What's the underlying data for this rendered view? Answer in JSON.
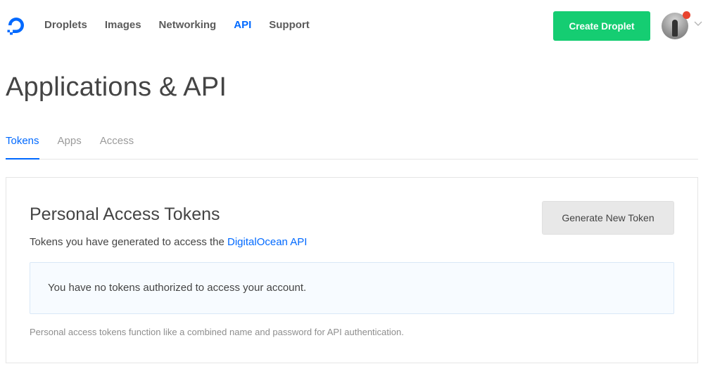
{
  "header": {
    "logo_icon": "digitalocean-logo-icon",
    "nav": [
      {
        "label": "Droplets",
        "active": false
      },
      {
        "label": "Images",
        "active": false
      },
      {
        "label": "Networking",
        "active": false
      },
      {
        "label": "API",
        "active": true
      },
      {
        "label": "Support",
        "active": false
      }
    ],
    "create_button_label": "Create Droplet",
    "avatar_icon": "user-avatar",
    "notification_color": "#e8442f",
    "accent_color": "#0069ff",
    "create_button_color": "#15cd72"
  },
  "page": {
    "title": "Applications & API",
    "tabs": [
      {
        "label": "Tokens",
        "active": true
      },
      {
        "label": "Apps",
        "active": false
      },
      {
        "label": "Access",
        "active": false
      }
    ]
  },
  "tokens_card": {
    "title": "Personal Access Tokens",
    "subtitle_prefix": "Tokens you have generated to access the ",
    "subtitle_link": "DigitalOcean API",
    "generate_button_label": "Generate New Token",
    "empty_message": "You have no tokens authorized to access your account.",
    "footnote": "Personal access tokens function like a combined name and password for API authentication."
  }
}
